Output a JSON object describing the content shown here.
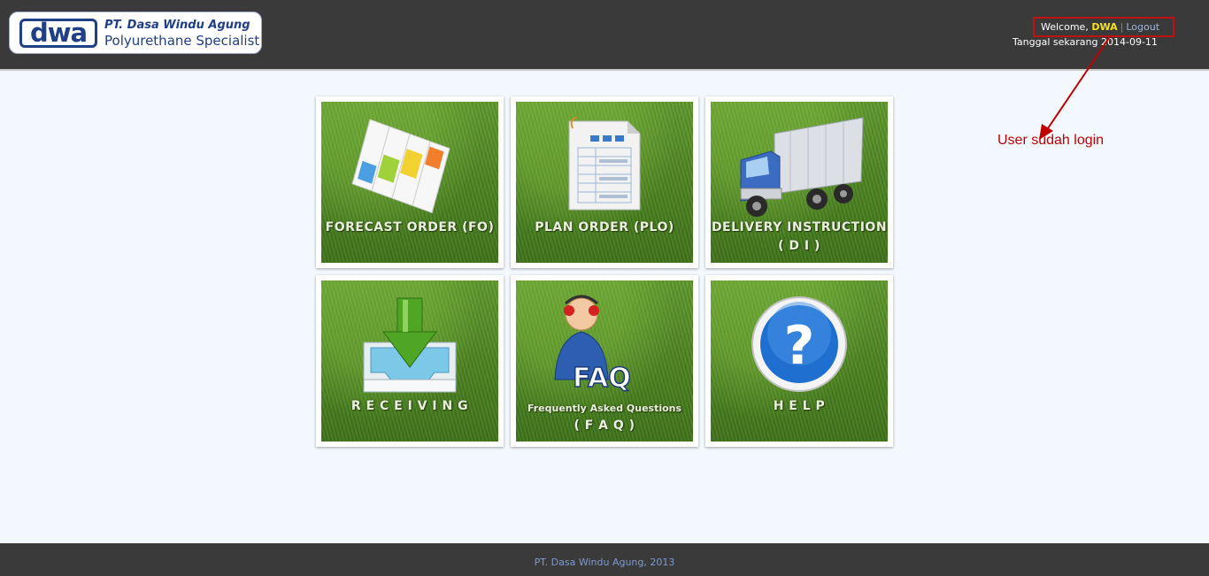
{
  "header": {
    "logo_mark": "dwa",
    "company_name": "PT. Dasa Windu Agung",
    "tagline": "Polyurethane Specialist",
    "welcome_prefix": "Welcome,",
    "username": "DWA",
    "logout_label": "Logout",
    "date_label": "Tanggal sekarang 2014-09-11"
  },
  "annotation": {
    "text": "User sudah login",
    "color": "#c00000"
  },
  "menu": {
    "tiles": [
      {
        "label": "FORECAST ORDER (FO)",
        "label2": "",
        "icon": "gantt-chart-icon"
      },
      {
        "label": "PLAN ORDER (PLO)",
        "label2": "",
        "icon": "spreadsheet-document-icon"
      },
      {
        "label": "DELIVERY INSTRUCTION",
        "label2": "( D I )",
        "icon": "delivery-truck-icon"
      },
      {
        "label": "R E C E I V I N G",
        "label2": "",
        "icon": "inbox-download-icon"
      },
      {
        "label": "Frequently Asked Questions",
        "label2": "( F A Q )",
        "icon": "faq-support-icon"
      },
      {
        "label": "H E L P",
        "label2": "",
        "icon": "help-question-icon"
      }
    ]
  },
  "footer": {
    "text": "PT. Dasa Windu Agung, 2013"
  },
  "colors": {
    "header_bg": "#3a3a3a",
    "page_bg": "#f3f8fe",
    "brand_blue": "#1f3f86",
    "grass_green": "#4c8421"
  }
}
